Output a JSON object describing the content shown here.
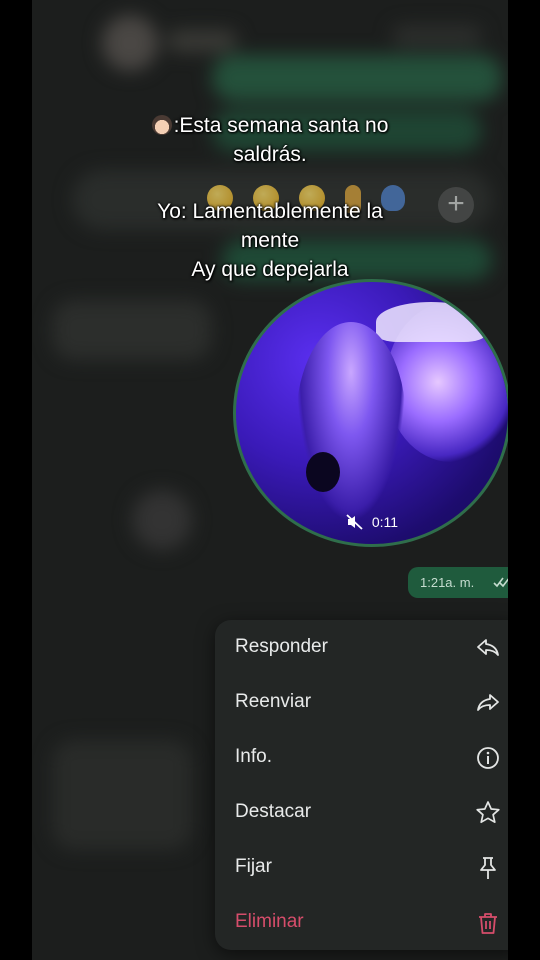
{
  "caption": {
    "line1": ":Esta semana santa no",
    "line2": "saldrás.",
    "line3": "Yo: Lamentablemente la",
    "line4": "mente",
    "line5": "Ay que depejarla"
  },
  "video_note": {
    "duration": "0:11",
    "muted": true
  },
  "message": {
    "time": "1:21a. m.",
    "status": "read"
  },
  "context_menu": {
    "items": [
      {
        "label": "Responder",
        "icon": "reply-icon"
      },
      {
        "label": "Reenviar",
        "icon": "forward-icon"
      },
      {
        "label": "Info.",
        "icon": "info-icon"
      },
      {
        "label": "Destacar",
        "icon": "star-icon"
      },
      {
        "label": "Fijar",
        "icon": "pin-icon"
      },
      {
        "label": "Eliminar",
        "icon": "trash-icon"
      }
    ]
  },
  "colors": {
    "background": "#1c1e1d",
    "sent_bubble": "#1f5b3d",
    "menu_bg": "#232625",
    "danger": "#d64d6b",
    "video_ring": "#2f6e4b"
  }
}
